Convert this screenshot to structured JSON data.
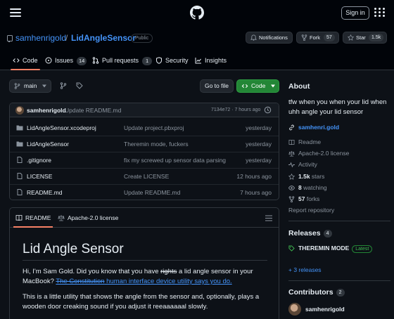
{
  "header": {
    "sign_in": "Sign in"
  },
  "repo": {
    "owner": "samhenrigold",
    "separator": "/",
    "name": "LidAngleSensor",
    "visibility": "Public",
    "notifications_label": "Notifications",
    "fork_label": "Fork",
    "fork_count": "57",
    "star_label": "Star",
    "star_count": "1.5k"
  },
  "tabs": [
    {
      "label": "Code",
      "count": ""
    },
    {
      "label": "Issues",
      "count": "14"
    },
    {
      "label": "Pull requests",
      "count": "1"
    },
    {
      "label": "Security",
      "count": ""
    },
    {
      "label": "Insights",
      "count": ""
    }
  ],
  "toolbar": {
    "branch": "main",
    "go_to_file": "Go to file",
    "code_button": "Code"
  },
  "latest_commit": {
    "author": "samhenrigold",
    "message": "Update README.md",
    "meta": "7134e72 · 7 hours ago"
  },
  "files": [
    {
      "name": "LidAngleSensor.xcodeproj",
      "message": "Update project.pbxproj",
      "date": "yesterday",
      "type": "folder"
    },
    {
      "name": "LidAngleSensor",
      "message": "Theremin mode, fuckers",
      "date": "yesterday",
      "type": "folder"
    },
    {
      "name": ".gitignore",
      "message": "fix my screwed up sensor data parsing",
      "date": "yesterday",
      "type": "file"
    },
    {
      "name": "LICENSE",
      "message": "Create LICENSE",
      "date": "12 hours ago",
      "type": "file"
    },
    {
      "name": "README.md",
      "message": "Update README.md",
      "date": "7 hours ago",
      "type": "file"
    }
  ],
  "readme": {
    "tab_readme": "README",
    "tab_license": "Apache-2.0 license",
    "title": "Lid Angle Sensor",
    "p1_a": "Hi, I'm Sam Gold. Did you know that you have ",
    "p1_strike": "rights",
    "p1_b": " a lid angle sensor in your MacBook? ",
    "p1_link_strike": "The Constitution",
    "p1_link": " human interface device utility says you do.",
    "p2": "This is a little utility that shows the angle from the sensor and, optionally, plays a wooden door creaking sound if you adjust it reeaaaaaal slowly."
  },
  "about": {
    "heading": "About",
    "description": "tfw when you when your lid when uhh angle your lid sensor",
    "website": "samhenri.gold",
    "readme": "Readme",
    "license": "Apache-2.0 license",
    "activity": "Activity",
    "stars_count": "1.5k",
    "stars_label": " stars",
    "watching_count": "8",
    "watching_label": " watching",
    "forks_count": "57",
    "forks_label": " forks",
    "report": "Report repository"
  },
  "releases": {
    "heading": "Releases",
    "count": "4",
    "latest_name": "THEREMIN MODE",
    "latest_badge": "Latest",
    "more": "+ 3 releases"
  },
  "contributors": {
    "heading": "Contributors",
    "count": "2",
    "name": "samhenrigold"
  },
  "colors": {
    "background": "#0d1117",
    "link": "#4493f8",
    "green": "#238636",
    "tab_underline": "#f78166"
  }
}
